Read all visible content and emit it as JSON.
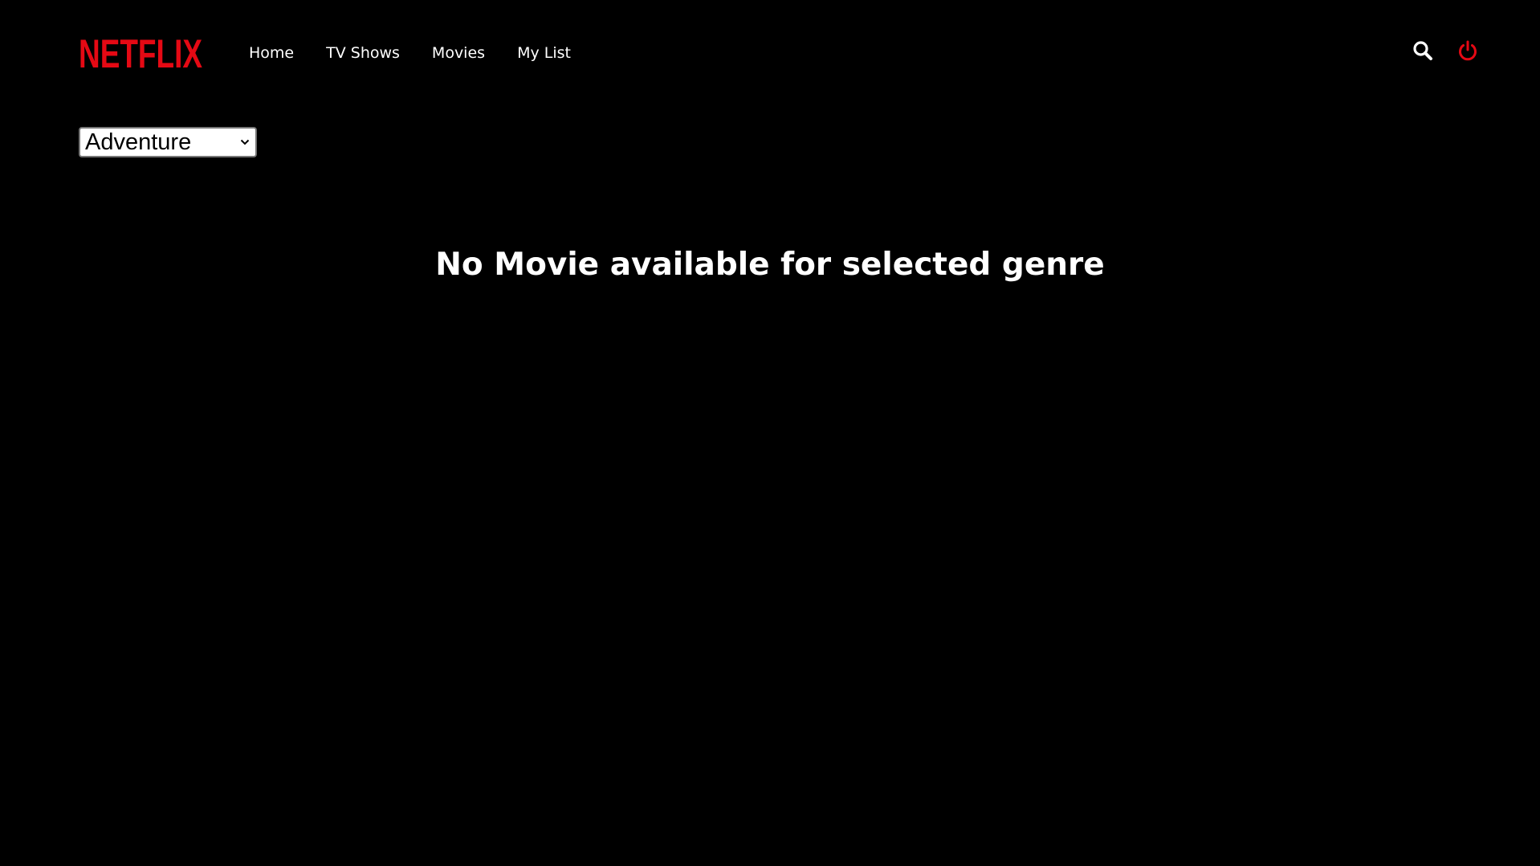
{
  "brand": {
    "logo_text": "NETFLIX",
    "logo_color": "#E50914"
  },
  "nav": {
    "items": [
      {
        "label": "Home"
      },
      {
        "label": "TV Shows"
      },
      {
        "label": "Movies"
      },
      {
        "label": "My List"
      }
    ]
  },
  "header_actions": {
    "search_icon": "search-icon",
    "power_icon": "power-icon",
    "power_color": "#E50914"
  },
  "filter": {
    "genre_selected": "Adventure"
  },
  "main": {
    "empty_message": "No Movie available for selected genre"
  },
  "colors": {
    "background": "#000000",
    "text": "#FFFFFF",
    "accent": "#E50914"
  }
}
